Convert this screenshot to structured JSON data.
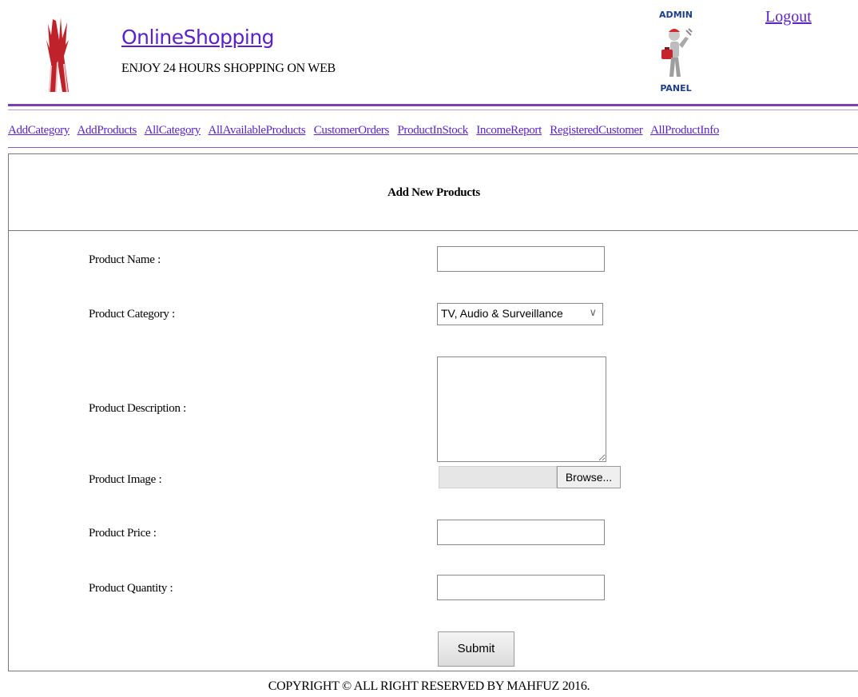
{
  "header": {
    "site_title": "OnlineShopping",
    "tagline": "ENJOY 24 HOURS SHOPPING ON WEB",
    "admin_top": "ADMIN",
    "admin_bottom": "PANEL",
    "logout_label": "Logout"
  },
  "nav": {
    "items": [
      "AddCategory",
      "AddProducts",
      "AllCategory",
      "AllAvailableProducts",
      "CustomerOrders",
      "ProductInStock",
      "IncomeReport",
      "RegisteredCustomer",
      "AllProductInfo"
    ]
  },
  "form": {
    "title": "Add New Products",
    "product_name_label": "Product Name :",
    "product_name_value": "",
    "product_category_label": "Product Category :",
    "product_category_value": "TV, Audio & Surveillance",
    "product_description_label": "Product Description :",
    "product_description_value": "",
    "product_image_label": "Product Image :",
    "browse_label": "Browse...",
    "product_price_label": "Product Price :",
    "product_price_value": "",
    "product_quantity_label": "Product Quantity :",
    "product_quantity_value": "",
    "submit_label": "Submit"
  },
  "footer": {
    "text": "COPYRIGHT © ALL RIGHT RESERVED BY MAHFUZ 2016."
  },
  "colors": {
    "link": "#5a1fcf",
    "rule": "#7a3fb0",
    "admin_text": "#1e3d8a",
    "logo": "#c0222b"
  },
  "icons": {
    "logo": "shop-logo",
    "admin": "admin-worker-icon",
    "select_arrow": "chevron-down-icon"
  }
}
